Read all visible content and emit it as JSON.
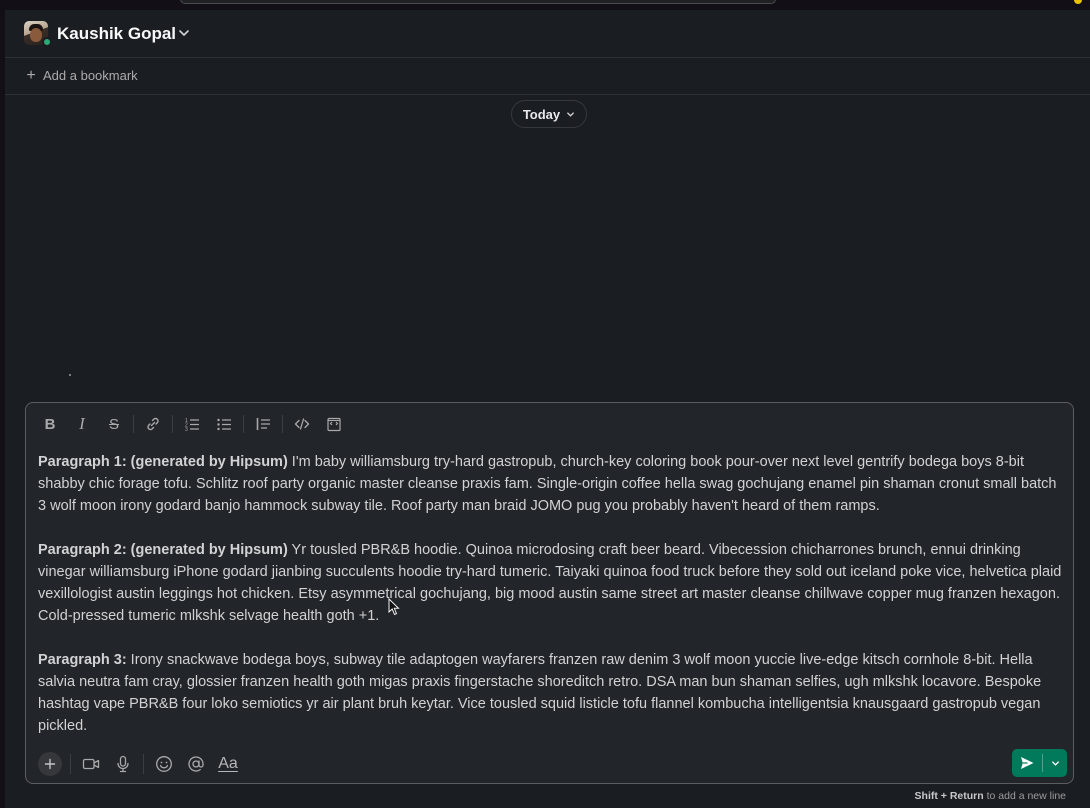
{
  "header": {
    "title": "Kaushik Gopal",
    "avatar_icon": "user-avatar",
    "presence_color": "#2bac76"
  },
  "bookmarks": {
    "add_label": "Add a bookmark"
  },
  "divider": {
    "date_label": "Today"
  },
  "composer": {
    "toolbar": {
      "bold_glyph": "B",
      "italic_glyph": "I",
      "strike_glyph": "S"
    },
    "paragraphs": [
      {
        "label": "Paragraph 1:  (generated by Hipsum)",
        "text": " I'm baby williamsburg try-hard gastropub, church-key coloring book pour-over next level gentrify bodega boys 8-bit shabby chic forage tofu. Schlitz roof party organic master cleanse praxis fam. Single-origin coffee hella swag gochujang enamel pin shaman cronut small batch 3 wolf moon irony godard banjo hammock subway tile. Roof party man braid JOMO pug you probably haven't heard of them ramps."
      },
      {
        "label": "Paragraph 2:  (generated by Hipsum)",
        "text": " Yr tousled PBR&B hoodie. Quinoa microdosing craft beer beard. Vibecession chicharrones brunch, ennui drinking vinegar williamsburg iPhone godard jianbing succulents hoodie try-hard tumeric. Taiyaki quinoa food truck before they sold out iceland poke vice, helvetica plaid vexillologist austin leggings hot chicken. Etsy asymmetrical gochujang, big mood austin same street art master cleanse chillwave copper mug franzen hexagon. Cold-pressed tumeric mlkshk selvage health goth +1."
      },
      {
        "label": "Paragraph 3:",
        "text": " Irony snackwave bodega boys, subway tile adaptogen wayfarers franzen raw denim 3 wolf moon yuccie live-edge kitsch cornhole 8-bit. Hella salvia neutra fam cray, glossier franzen health goth migas praxis fingerstache shoreditch retro. DSA man bun shaman selfies, ugh mlkshk locavore. Bespoke hashtag vape PBR&B four loko semiotics yr air plant bruh keytar. Vice tousled squid listicle tofu flannel kombucha intelligentsia knausgaard gastropub vegan pickled."
      }
    ],
    "format_glyph": "Aa",
    "send_color": "#007a5a"
  },
  "footer": {
    "hint_keys": "Shift + Return",
    "hint_text": " to add a new line"
  }
}
